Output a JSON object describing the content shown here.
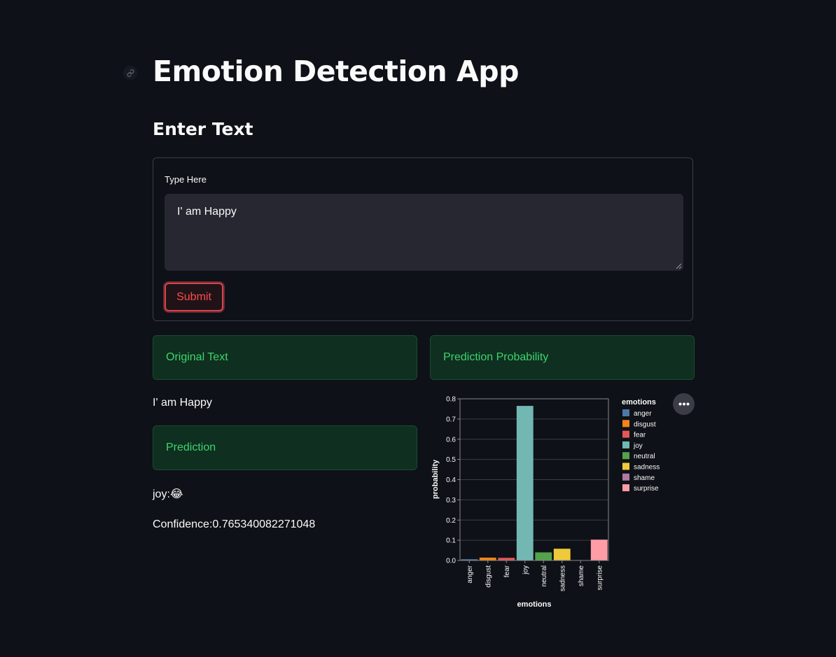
{
  "app": {
    "title": "Emotion Detection App",
    "section_title": "Enter Text"
  },
  "form": {
    "label": "Type Here",
    "value": "I' am Happy",
    "submit_label": "Submit"
  },
  "results": {
    "original_header": "Original Text",
    "original_text": "I' am Happy",
    "prediction_header": "Prediction",
    "prediction_text": "joy:😂",
    "confidence_text": "Confidence:0.765340082271048",
    "probability_header": "Prediction Probability"
  },
  "colors": {
    "background": "#0e1117",
    "success_bg": "#0f2f20",
    "success_text": "#3dd56d",
    "accent": "#ff4b4b"
  },
  "chart_data": {
    "type": "bar",
    "xlabel": "emotions",
    "ylabel": "probability",
    "ylim": [
      0,
      0.8
    ],
    "yticks": [
      "0.0",
      "0.1",
      "0.2",
      "0.3",
      "0.4",
      "0.5",
      "0.6",
      "0.7",
      "0.8"
    ],
    "grid": true,
    "legend_title": "emotions",
    "legend_position": "right",
    "categories": [
      "anger",
      "disgust",
      "fear",
      "joy",
      "neutral",
      "sadness",
      "shame",
      "surprise"
    ],
    "values": [
      0.006,
      0.014,
      0.013,
      0.765,
      0.04,
      0.058,
      0.001,
      0.103
    ],
    "colors": [
      "#4c78a8",
      "#f58518",
      "#e45756",
      "#72b7b2",
      "#54a24b",
      "#eeca3b",
      "#b279a2",
      "#ff9da6"
    ]
  }
}
